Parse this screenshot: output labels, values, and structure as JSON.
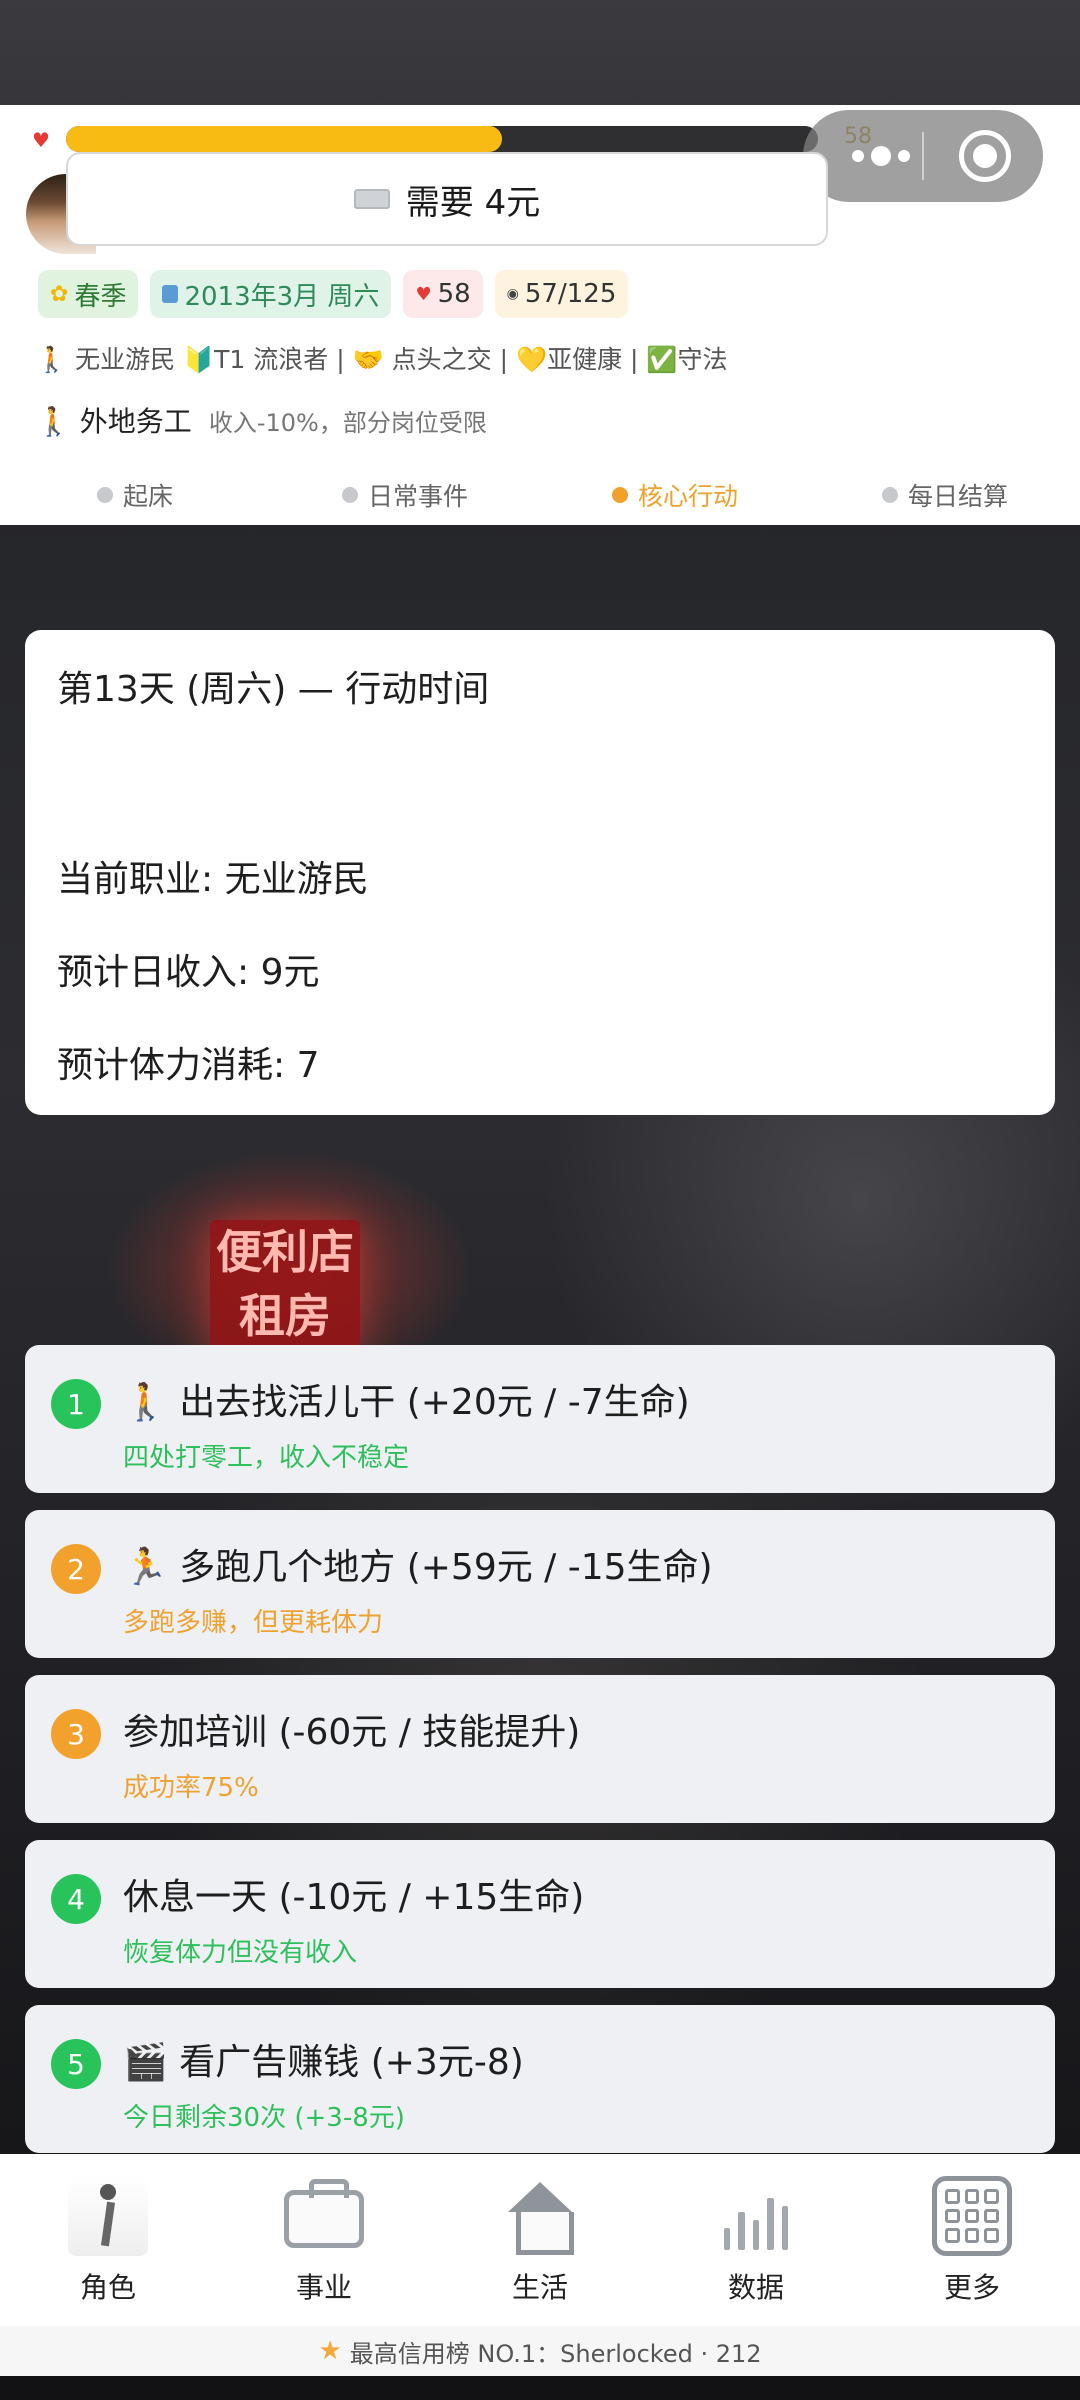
{
  "header": {
    "hp_value": "58",
    "hp_fraction": 0.58,
    "need_text": "需要 4元",
    "chips": {
      "season": "春季",
      "date": "2013年3月 周六",
      "hp": "58",
      "xp": "57/125"
    },
    "tags_line": "🚶 无业游民 🔰T1 流浪者 | 🤝 点头之交 | 💛亚健康 | ✅守法",
    "status": {
      "title": "🚶 外地务工",
      "desc": "收入-10%，部分岗位受限"
    },
    "phases": [
      {
        "label": "起床",
        "active": false
      },
      {
        "label": "日常事件",
        "active": false
      },
      {
        "label": "核心行动",
        "active": true
      },
      {
        "label": "每日结算",
        "active": false
      }
    ]
  },
  "info": {
    "line1": "第13天 (周六) — 行动时间",
    "line2": "当前职业: 无业游民",
    "line3": "预计日收入: 9元",
    "line4": "预计体力消耗: 7"
  },
  "background": {
    "sign_line1": "便利店",
    "sign_line2": "租房"
  },
  "actions": [
    {
      "num": "1",
      "title": "🚶 出去找活儿干 (+20元 / -7生命)",
      "sub": "四处打零工，收入不稳定",
      "color": "#29c35c"
    },
    {
      "num": "2",
      "title": "🏃 多跑几个地方 (+59元 / -15生命)",
      "sub": "多跑多赚，但更耗体力",
      "color": "#f2a22c"
    },
    {
      "num": "3",
      "title": "参加培训 (-60元 / 技能提升)",
      "sub": "成功率75%",
      "color": "#f2a22c"
    },
    {
      "num": "4",
      "title": "休息一天 (-10元 / +15生命)",
      "sub": "恢复体力但没有收入",
      "color": "#29c35c"
    },
    {
      "num": "5",
      "title": "🎬 看广告赚钱 (+3元-8)",
      "sub": "今日剩余30次 (+3-8元)",
      "color": "#29c35c"
    }
  ],
  "nav": {
    "tabs": [
      {
        "label": "角色",
        "icon": "walking-person-icon"
      },
      {
        "label": "事业",
        "icon": "briefcase-icon"
      },
      {
        "label": "生活",
        "icon": "house-icon"
      },
      {
        "label": "数据",
        "icon": "bar-chart-icon"
      },
      {
        "label": "更多",
        "icon": "grid-icon"
      }
    ]
  },
  "footer": {
    "text": "最高信用榜 NO.1：Sherlocked · 212"
  },
  "colors": {
    "accent_orange": "#f0a02b",
    "accent_green": "#29c35c",
    "hp_bar": "#f7bb13"
  }
}
